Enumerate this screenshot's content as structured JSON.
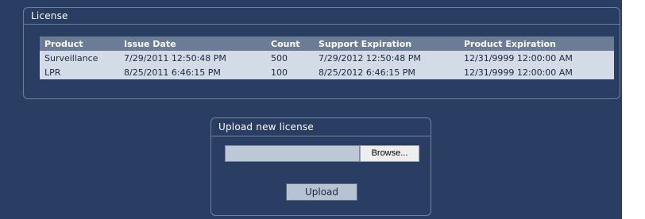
{
  "license_section": {
    "title": "License",
    "columns": [
      "Product",
      "Issue Date",
      "Count",
      "Support Expiration",
      "Product Expiration"
    ],
    "rows": [
      [
        "Surveillance",
        "7/29/2011 12:50:48 PM",
        "500",
        "7/29/2012 12:50:48 PM",
        "12/31/9999 12:00:00 AM"
      ],
      [
        "LPR",
        "8/25/2011 6:46:15 PM",
        "100",
        "8/25/2012 6:46:15 PM",
        "12/31/9999 12:00:00 AM"
      ]
    ]
  },
  "upload_section": {
    "title": "Upload new license",
    "file_value": "",
    "browse_label": "Browse...",
    "upload_label": "Upload"
  },
  "colors": {
    "background": "#2a3e63",
    "header_row": "#6b7c96",
    "data_row": "#d2dbe6",
    "border": "#71819b"
  }
}
